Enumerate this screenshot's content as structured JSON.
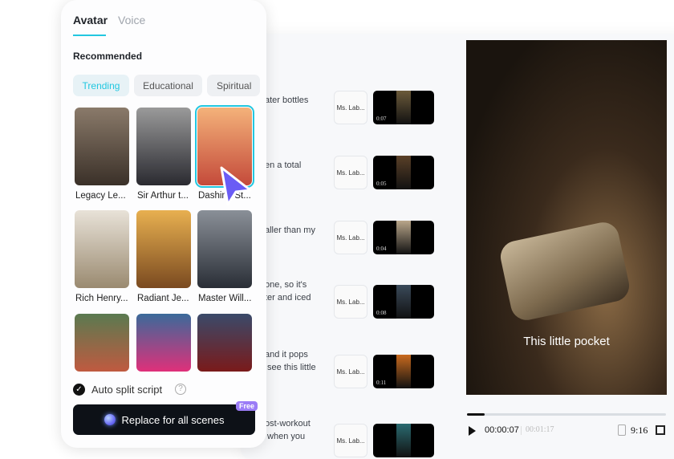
{
  "panel": {
    "tabs": [
      "Avatar",
      "Voice"
    ],
    "section": "Recommended",
    "chips": [
      "Trending",
      "Educational",
      "Spiritual"
    ],
    "avatars": [
      "Legacy Le...",
      "Sir Arthur t...",
      "Dashing St...",
      "Rich Henry...",
      "Radiant Je...",
      "Master Will...",
      "",
      "",
      ""
    ],
    "auto_split": "Auto split script",
    "replace": "Replace for all scenes",
    "free_badge": "Free"
  },
  "script": {
    "rows": [
      {
        "text": "ater bottles",
        "voice": "Ms. Lab...",
        "duration": "0:07"
      },
      {
        "text": "en a total",
        "voice": "Ms. Lab...",
        "duration": "0:05"
      },
      {
        "text": "aller than my",
        "voice": "Ms. Lab...",
        "duration": "0:04"
      },
      {
        "text": "one, so it's\nter and iced",
        "voice": "Ms. Lab...",
        "duration": "0:08"
      },
      {
        "text": "and it pops\n see this little",
        "voice": "Ms. Lab...",
        "duration": "0:11"
      },
      {
        "text": "ost-workout\n when you",
        "voice": "Ms. Lab...",
        "duration": ""
      }
    ]
  },
  "player": {
    "caption": "This little pocket",
    "current": "00:00:07",
    "total": "00:01:17",
    "ratio": "9:16",
    "progress": 0.09
  }
}
